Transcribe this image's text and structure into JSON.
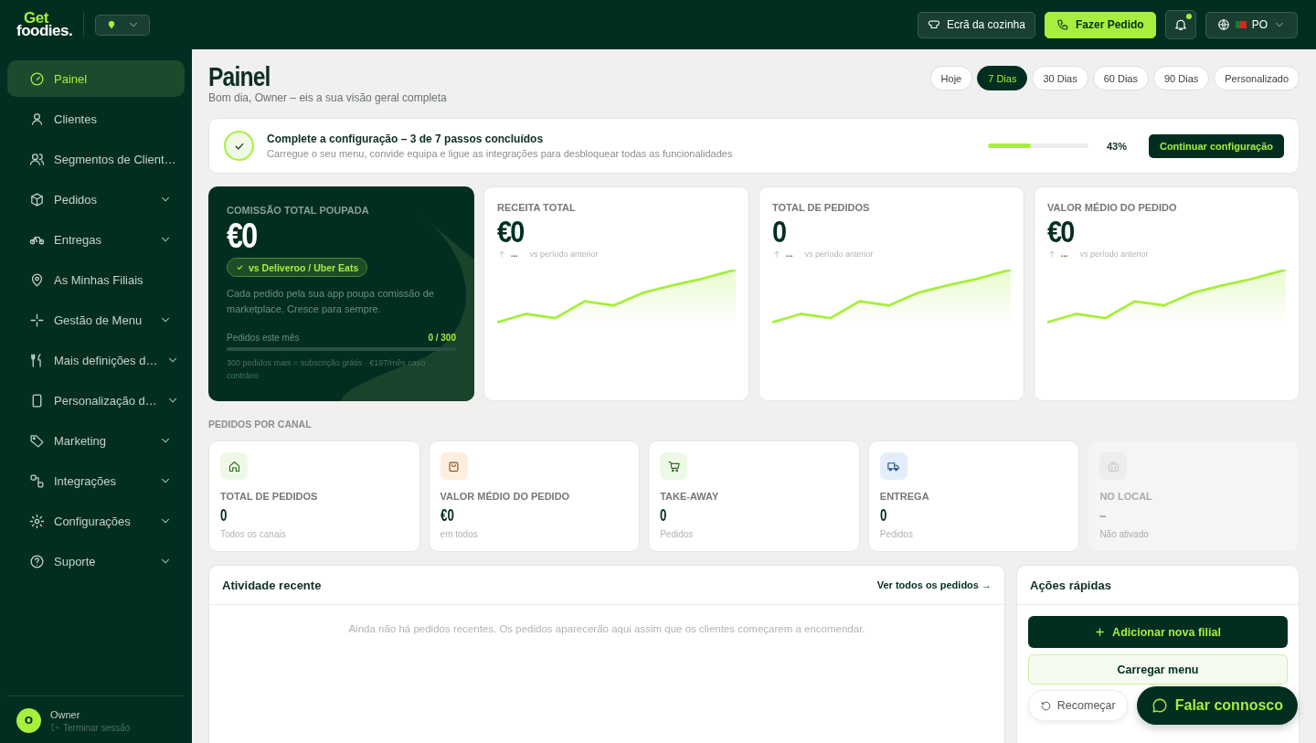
{
  "brand": {
    "line_1": "Get",
    "line_2": "foodies."
  },
  "topbar": {
    "kitchen_button": "Ecrã da cozinha",
    "order_button": "Fazer Pedido",
    "notifications": {
      "unread": true
    },
    "language": "PO"
  },
  "sidebar": {
    "items": [
      {
        "label": "Painel",
        "selected": true,
        "expandable": false
      },
      {
        "label": "Clientes",
        "selected": false,
        "expandable": false
      },
      {
        "label": "Segmentos de Client…",
        "selected": false,
        "expandable": false
      },
      {
        "label": "Pedidos",
        "selected": false,
        "expandable": true
      },
      {
        "label": "Entregas",
        "selected": false,
        "expandable": true
      },
      {
        "label": "As Minhas Filiais",
        "selected": false,
        "expandable": false
      },
      {
        "label": "Gestão de Menu",
        "selected": false,
        "expandable": true
      },
      {
        "label": "Mais definições d…",
        "selected": false,
        "expandable": true
      },
      {
        "label": "Personalização d…",
        "selected": false,
        "expandable": true
      },
      {
        "label": "Marketing",
        "selected": false,
        "expandable": true
      },
      {
        "label": "Integrações",
        "selected": false,
        "expandable": true
      },
      {
        "label": "Configurações",
        "selected": false,
        "expandable": true
      },
      {
        "label": "Suporte",
        "selected": false,
        "expandable": true
      }
    ],
    "user": {
      "initial": "O",
      "name": "Owner",
      "logout": "Terminar sessão"
    }
  },
  "page": {
    "title": "Painel",
    "subtitle": "Bom dia, Owner – eis a sua visão geral completa"
  },
  "ranges": [
    {
      "label": "Hoje",
      "selected": false
    },
    {
      "label": "7 Dias",
      "selected": true
    },
    {
      "label": "30 Dias",
      "selected": false
    },
    {
      "label": "60 Dias",
      "selected": false
    },
    {
      "label": "90 Dias",
      "selected": false
    },
    {
      "label": "Personalizado",
      "selected": false
    }
  ],
  "setup": {
    "title": "Complete a configuração – 3 de 7 passos concluídos",
    "subtitle": "Carregue o seu menu, convide equipa e ligue as integrações para desbloquear todas as funcionalidades",
    "level": 0.43,
    "percent": "43%",
    "button": "Continuar configuração"
  },
  "commission": {
    "label": "COMISSÃO TOTAL POUPADA",
    "value": "€0",
    "badge": "vs Deliveroo / Uber Eats",
    "text": "Cada pedido pela sua app poupa comissão de marketplace. Cresce para sempre.",
    "progress_label": "Pedidos este mês",
    "progress_value": "0 / 300",
    "level": 0,
    "note": "300 pedidos mais = subscrição grátis · €197/mês caso contrário"
  },
  "metrics": [
    {
      "label": "RECEITA TOTAL",
      "value": "€0",
      "trend": "...",
      "compare": "vs período anterior"
    },
    {
      "label": "TOTAL DE PEDIDOS",
      "value": "0",
      "trend": "...",
      "compare": "vs período anterior"
    },
    {
      "label": "VALOR MÉDIO DO PEDIDO",
      "value": "€0",
      "trend": "...",
      "compare": "vs período anterior"
    }
  ],
  "channels_title": "PEDIDOS POR CANAL",
  "channels": [
    {
      "label": "TOTAL DE PEDIDOS",
      "value": "0",
      "note": "Todos os canais",
      "disabled": false
    },
    {
      "label": "VALOR MÉDIO DO PEDIDO",
      "value": "€0",
      "note": "em todos",
      "disabled": false
    },
    {
      "label": "TAKE-AWAY",
      "value": "0",
      "note": "Pedidos",
      "disabled": false
    },
    {
      "label": "ENTREGA",
      "value": "0",
      "note": "Pedidos",
      "disabled": false
    },
    {
      "label": "NO LOCAL",
      "value": "–",
      "note": "Não ativado",
      "disabled": true
    }
  ],
  "activity": {
    "title": "Atividade recente",
    "link": "Ver todos os pedidos →",
    "empty": "Ainda não há pedidos recentes. Os pedidos aparecerão aqui assim que os clientes começarem a encomendar."
  },
  "quick_actions": {
    "title": "Ações rápidas",
    "buttons": [
      {
        "kind": "primary",
        "label": "Adicionar nova filial"
      },
      {
        "kind": "secondary",
        "label": "Carregar menu"
      }
    ]
  },
  "floating": {
    "restart": "Recomeçar",
    "chat": "Falar connosco"
  }
}
